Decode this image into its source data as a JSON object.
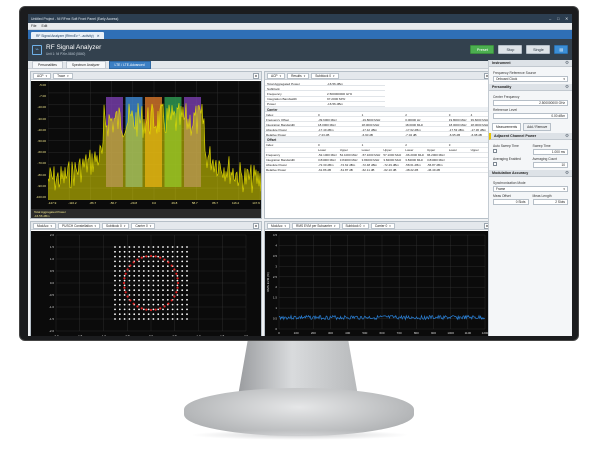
{
  "window": {
    "title": "Untitled Project - NI RFmx Soft Front Panel (Early Access)",
    "controls": [
      "–",
      "□",
      "✕"
    ]
  },
  "menu": [
    "File",
    "Edit"
  ],
  "doc_tab": {
    "label": "RF Signal Analyzer (RfmxEv *...activity)",
    "close": "✕"
  },
  "header": {
    "title": "RF Signal Analyzer",
    "subtitle": "Unit 1: NI PXIe-5840 (5840)",
    "buttons": {
      "run": "Preset",
      "stop": "Stop",
      "single": "Single"
    }
  },
  "subtabs": [
    "Personalities",
    "Spectrum Analyzer",
    "LTE / LTE-Advanced"
  ],
  "spectrum_pane": {
    "dropdowns": [
      "ACP",
      "Trace"
    ],
    "y_ticks": [
      "-5.00",
      "-7.00",
      "-20.00",
      "-30.00",
      "-40.00",
      "-50.00",
      "-60.00",
      "-70.00",
      "-80.00",
      "-90.00",
      "-100.00"
    ],
    "x_ticks": [
      "-147.9",
      "-116.2",
      "-86.7",
      "-56.7",
      "-29.8",
      "0.0",
      "29.8",
      "58.7",
      "86.7",
      "116.2",
      "147.9"
    ],
    "x_unit": "MHz",
    "aggr_label": "Total Aggregated Power",
    "aggr_value": "-16.56 dBm"
  },
  "results_pane": {
    "dropdowns": [
      "ACP",
      "Results",
      "Subblock 0"
    ],
    "summary": [
      [
        "Total Aggregated Power",
        "-16.56 dBm"
      ],
      [
        "Subblock",
        ""
      ],
      [
        "Frequency",
        "2.500000000 GHz"
      ],
      [
        "Integration Bandwidth",
        "97.2000 MHz"
      ],
      [
        "Power",
        "-16.56 dBm"
      ]
    ],
    "carrier_label": "Carrier",
    "carrier_rows": [
      [
        "Index",
        "0",
        "",
        "1",
        "",
        "2",
        "",
        "3",
        "4"
      ],
      [
        "Frequency Offset",
        "-39.6000 MHz",
        "",
        "-19.8000 MHz",
        "",
        "0.00000 Hz",
        "",
        "19.8000 MHz",
        "39.6000 MHz"
      ],
      [
        "Integration Bandwidth",
        "18.0000 MHz",
        "",
        "18.0000 MHz",
        "",
        "18.0000 MHz",
        "",
        "18.0000 MHz",
        "18.0000 MHz"
      ],
      [
        "Absolute Power",
        "-17.49 dBm",
        "",
        "-17.42 dBm",
        "",
        "-17.62 dBm",
        "",
        "-17.53 dBm",
        "-17.36 dBm"
      ],
      [
        "Relative Power",
        "-7.23 dB",
        "",
        "-6.90 dB",
        "",
        "-7.04 dB",
        "",
        "-6.95 dB",
        "-6.98 dB"
      ]
    ],
    "offset_label": "Offset",
    "offset_rows": [
      [
        "Index",
        "0",
        "",
        "1",
        "",
        "2",
        "",
        "3",
        ""
      ],
      [
        "",
        "Lower",
        "Upper",
        "Lower",
        "Upper",
        "Lower",
        "Upper",
        "Lower",
        "Upper"
      ],
      [
        "Frequency",
        "-52.1000 MHz",
        "52.1000 MHz",
        "-57.1000 MHz",
        "57.1000 MHz",
        "-96.2000 MHz",
        "96.2000 MHz",
        "",
        ""
      ],
      [
        "Integration Bandwidth",
        "3.84000 MHz",
        "3.84000 MHz",
        "3.84000 MHz",
        "3.84000 MHz",
        "3.84000 MHz",
        "3.84000 MHz",
        "",
        ""
      ],
      [
        "Absolute Power",
        "-72.30 dBm",
        "-72.62 dBm",
        "-72.48 dBm",
        "-72.49 dBm",
        "-58.61 dBm",
        "-56.87 dBm",
        "",
        ""
      ],
      [
        "Relative Power",
        "-61.86 dB",
        "-61.87 dB",
        "-62.11 dB",
        "-62.10 dB",
        "-48.22 dB",
        "-46.49 dB",
        "",
        ""
      ]
    ]
  },
  "constellation_pane": {
    "dropdowns": [
      "ModAcc",
      "PUSCH Constellation",
      "Subblock 0",
      "Carrier 0"
    ],
    "axis_ticks": [
      "-2.0",
      "-1.5",
      "-1.0",
      "-0.5",
      "0.0",
      "0.5",
      "1.0",
      "1.5",
      "2.0"
    ]
  },
  "evm_pane": {
    "dropdowns": [
      "ModAcc",
      "RMS EVM per Subcarrier",
      "Subblock 0",
      "Carrier 0"
    ],
    "y_ticks": [
      "4.5",
      "4",
      "3.5",
      "3",
      "2.5",
      "2",
      "1.5",
      "1",
      "0.5",
      "0"
    ],
    "x_ticks": [
      "0",
      "100",
      "200",
      "300",
      "400",
      "500",
      "600",
      "700",
      "800",
      "900",
      "1000",
      "1100",
      "1200"
    ],
    "x_label": "Subcarrier",
    "y_label": "RMS EVM (%)"
  },
  "right_panel": {
    "instrument": {
      "title": "Instrument",
      "ref_label": "Frequency Reference Source",
      "ref_value": "Onboard Clock"
    },
    "personality": {
      "title": "Personality",
      "freq_label": "Center Frequency",
      "freq_value": "2.500000000 GHz",
      "ref_level_label": "Reference Level",
      "ref_level_value": "0.00 dBm"
    },
    "measurements": {
      "tab": "Measurements",
      "add_remove": "Add / Remove",
      "acp_title": "Adjacent Channel Power",
      "auto_sweep_label": "Auto Sweep Time",
      "sweep_time_label": "Sweep Time",
      "sweep_time_value": "1.000 ms",
      "avg_enabled_label": "Averaging Enabled",
      "avg_count_label": "Averaging Count",
      "avg_count_value": "10",
      "modacc_title": "Modulation Accuracy",
      "sync_label": "Synchronization Mode",
      "sync_value": "Frame",
      "meas_offset_label": "Meas Offset",
      "meas_offset_value": "0 Slots",
      "meas_length_label": "Meas Length",
      "meas_length_value": "2 Slots"
    }
  },
  "colors": {
    "trace_yellow": "#e8e000",
    "carrier_fill_1": "#7a3fb0",
    "carrier_fill_2": "#3e8ad6",
    "carrier_fill_3": "#d8772a",
    "carrier_fill_4": "#2f9d55",
    "constellation_points": "#ffffff",
    "constellation_ring": "#e02020",
    "evm_trace": "#2a7fd4"
  }
}
